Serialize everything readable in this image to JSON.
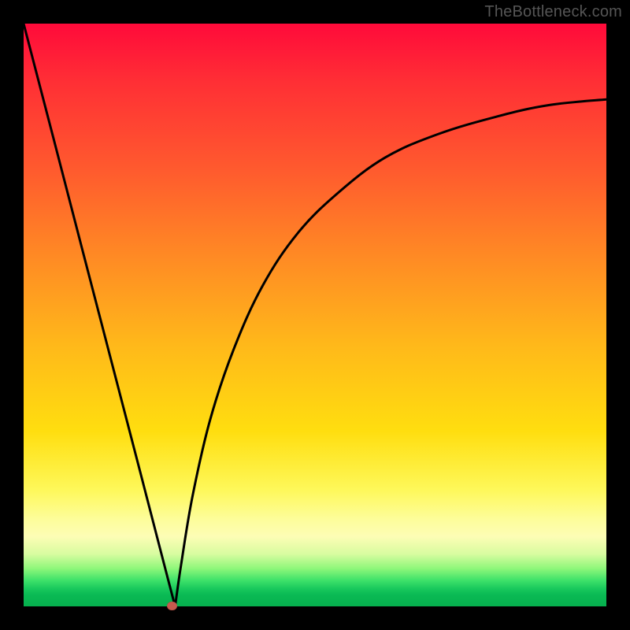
{
  "watermark": "TheBottleneck.com",
  "chart_data": {
    "type": "line",
    "title": "",
    "xlabel": "",
    "ylabel": "",
    "xlim": [
      0,
      1
    ],
    "ylim": [
      0,
      1
    ],
    "series": [
      {
        "name": "left-segment",
        "x": [
          0.0,
          0.05,
          0.1,
          0.15,
          0.2,
          0.23,
          0.25,
          0.26
        ],
        "y": [
          1.0,
          0.808,
          0.615,
          0.423,
          0.231,
          0.115,
          0.038,
          0.0
        ]
      },
      {
        "name": "right-segment",
        "x": [
          0.26,
          0.27,
          0.29,
          0.32,
          0.36,
          0.41,
          0.47,
          0.54,
          0.62,
          0.71,
          0.81,
          0.9,
          1.0
        ],
        "y": [
          0.0,
          0.07,
          0.19,
          0.32,
          0.44,
          0.55,
          0.64,
          0.71,
          0.77,
          0.81,
          0.84,
          0.86,
          0.87
        ]
      }
    ],
    "marker": {
      "x": 0.255,
      "y": 0.0
    },
    "grid": false,
    "legend": false
  }
}
